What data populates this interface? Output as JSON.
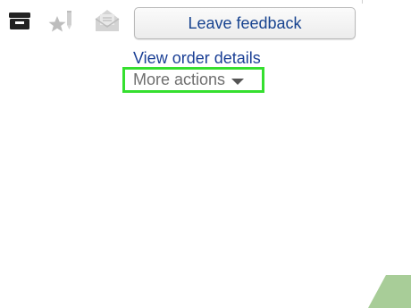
{
  "toolbar": {
    "icons": [
      "box-icon",
      "star-rating-icon",
      "envelope-icon"
    ]
  },
  "actions": {
    "leave_feedback_label": "Leave feedback",
    "view_order_details_label": "View order details",
    "more_actions_label": "More actions"
  },
  "colors": {
    "link": "#1a3f95",
    "muted_text": "#6f6f6f",
    "highlight": "#35df2f",
    "corner_accent": "#a8cd98"
  }
}
